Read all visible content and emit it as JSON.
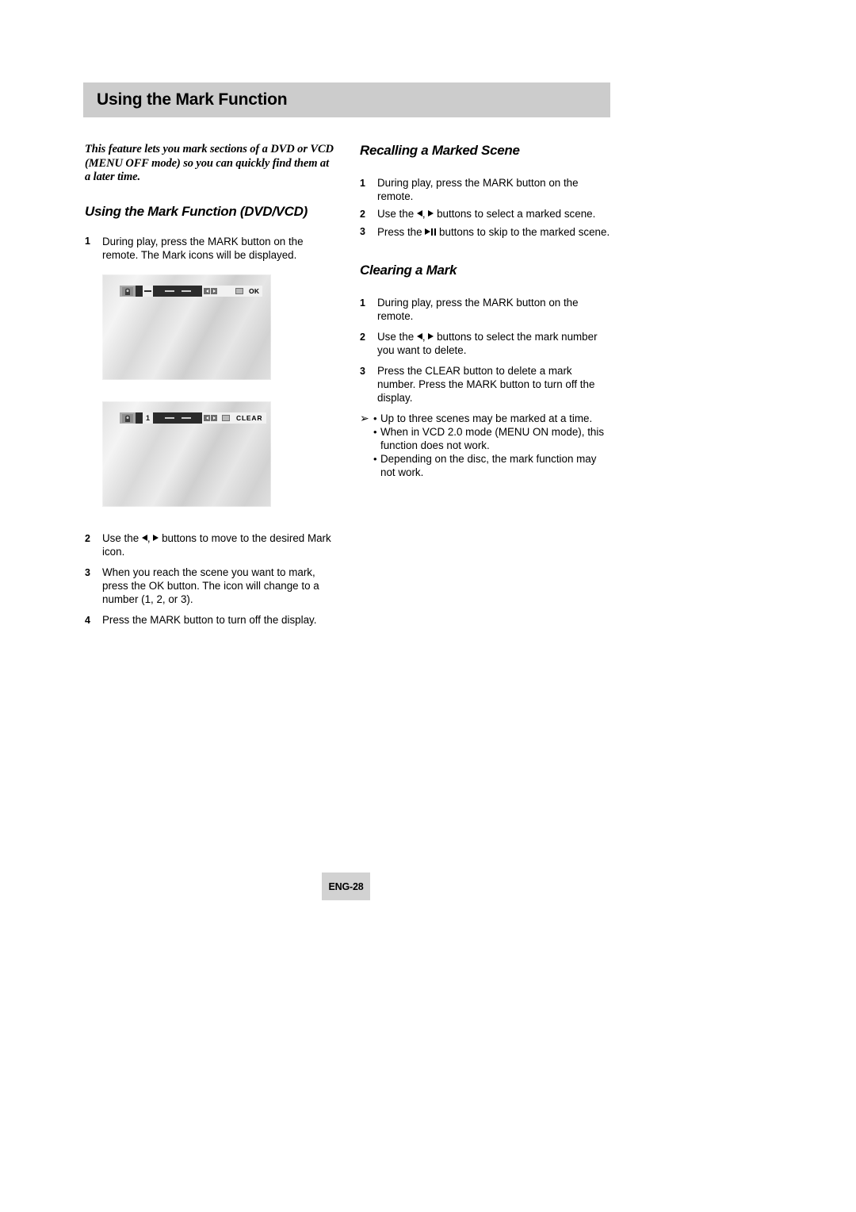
{
  "header": {
    "title": "Using the Mark Function"
  },
  "left_column": {
    "intro": "This feature lets you mark sections of a DVD or VCD (MENU OFF mode) so you can quickly find them at a later time.",
    "section_heading": "Using the Mark Function (DVD/VCD)",
    "step1": {
      "num": "1",
      "text": "During play, press the MARK button on the remote. The Mark icons will be displayed."
    },
    "step2": {
      "num": "2",
      "text_before": "Use the",
      "text_after": "buttons to move to the desired Mark icon."
    },
    "step3": {
      "num": "3",
      "text": "When you reach the scene you want to mark, press the OK button. The icon will change to a number (1, 2, or 3)."
    },
    "step4": {
      "num": "4",
      "text": "Press the MARK button to turn off the display."
    }
  },
  "figures": {
    "figure1": {
      "caption_label": "mark-icons-osd-screen",
      "ok_label": "OK",
      "mark_slots": 2,
      "mark_state": "empty"
    },
    "figure2": {
      "caption_label": "mark-number-osd-screen",
      "mark_number": "1",
      "clear_label": "CLEAR",
      "mark_slots": 2,
      "mark_state": "numbered"
    }
  },
  "right_column": {
    "recalling": {
      "heading": "Recalling a Marked Scene",
      "step1": {
        "num": "1",
        "text": "During play, press the MARK button on the remote."
      },
      "step2": {
        "num": "2",
        "text_before": "Use the",
        "text_after": "buttons to select a marked scene."
      },
      "step3": {
        "num": "3",
        "text_before": "Press the",
        "text_after": "buttons to skip to the marked scene."
      }
    },
    "clearing": {
      "heading": "Clearing a Mark",
      "step1": {
        "num": "1",
        "text": "During play, press the MARK button on the remote."
      },
      "step2": {
        "num": "2",
        "text_before": "Use the",
        "text_after": "buttons to select the mark number you want to delete."
      },
      "step3": {
        "num": "3",
        "text": "Press the CLEAR button to delete a mark number. Press the MARK button to turn off the display."
      },
      "note": {
        "arrow": "➢",
        "bullet": "•",
        "items": [
          "Up to three scenes may be marked at a time.",
          "When in VCD 2.0 mode (MENU ON mode), this function does not work.",
          "Depending on the disc, the mark function may not work."
        ]
      }
    }
  },
  "footer": {
    "page_label": "ENG-28"
  },
  "colors": {
    "header_bar": "#cccccc",
    "page_badge": "#d2d2d2",
    "osd_dark": "#2b2b2b",
    "osd_light": "#f1f1f1",
    "text": "#000000"
  }
}
